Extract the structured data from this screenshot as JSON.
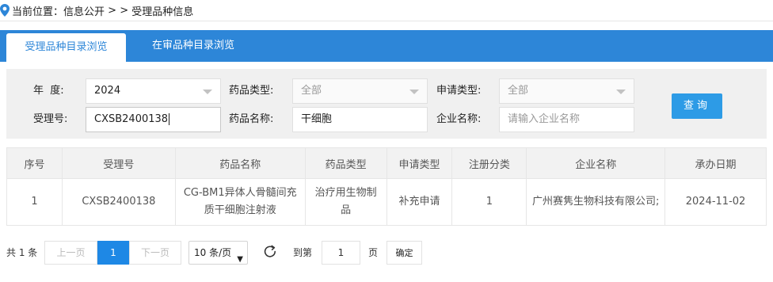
{
  "breadcrumb": {
    "prefix": "当前位置：",
    "section": "信息公开",
    "separator": " > > ",
    "current": "受理品种信息"
  },
  "tabs": [
    {
      "label": "受理品种目录浏览",
      "active": true
    },
    {
      "label": "在审品种目录浏览",
      "active": false
    }
  ],
  "filters": {
    "year": {
      "label": "年  度:",
      "value": "2024"
    },
    "drug_type": {
      "label": "药品类型:",
      "value": "全部"
    },
    "apply_type": {
      "label": "申请类型:",
      "value": "全部"
    },
    "accept_no": {
      "label": "受理号:",
      "value": "CXSB2400138"
    },
    "drug_name": {
      "label": "药品名称:",
      "value": "干细胞"
    },
    "company": {
      "label": "企业名称:",
      "placeholder": "请输入企业名称"
    },
    "search_label": "查询"
  },
  "table": {
    "headers": [
      "序号",
      "受理号",
      "药品名称",
      "药品类型",
      "申请类型",
      "注册分类",
      "企业名称",
      "承办日期"
    ],
    "rows": [
      [
        "1",
        "CXSB2400138",
        "CG-BM1异体人骨髓间充质干细胞注射液",
        "治疗用生物制品",
        "补充申请",
        "1",
        "广州赛隽生物科技有限公司;",
        "2024-11-02"
      ]
    ]
  },
  "pagination": {
    "total": "共 1 条",
    "prev": "上一页",
    "current_page": "1",
    "next": "下一页",
    "page_size": "10 条/页",
    "goto_prefix": "到第",
    "goto_value": "1",
    "goto_suffix": "页",
    "confirm": "确定"
  },
  "colors": {
    "tab_bar": "#2d86d8",
    "search_button": "#2d9be6",
    "current_page": "#1e88e5"
  },
  "icons": {
    "location": "location-pin-icon",
    "dropdown": "chevron-down-icon",
    "refresh": "refresh-icon"
  }
}
